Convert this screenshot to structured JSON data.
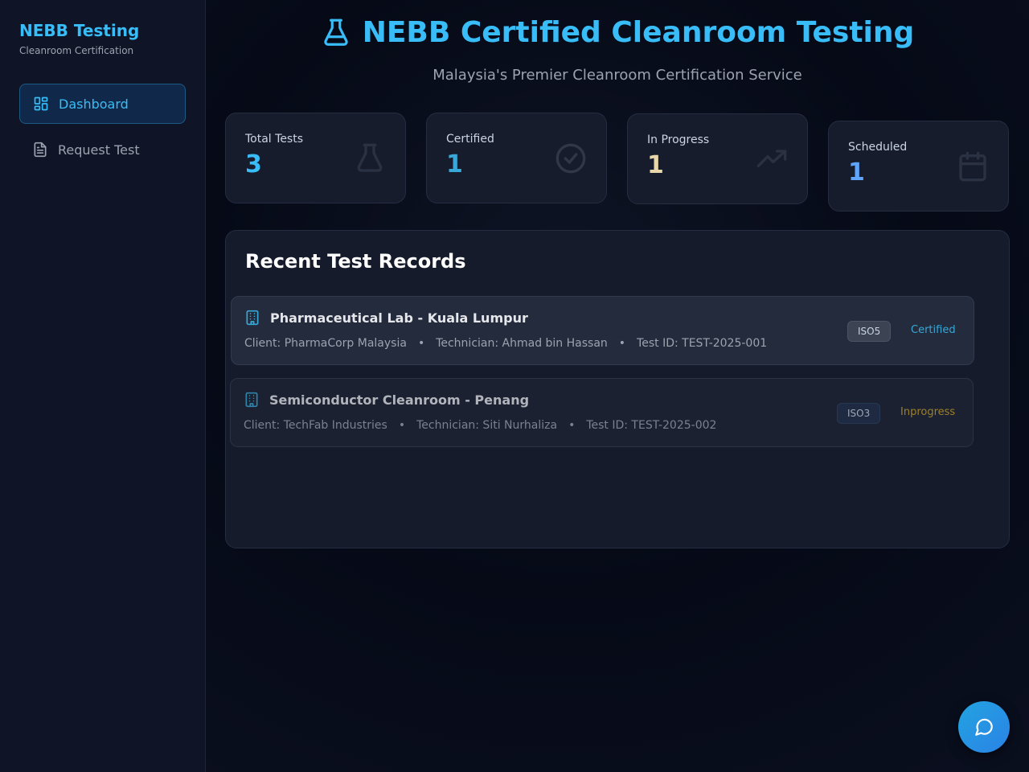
{
  "sidebar": {
    "title": "NEBB Testing",
    "subtitle": "Cleanroom Certification",
    "items": [
      {
        "label": "Dashboard",
        "icon": "dashboard-icon",
        "active": true
      },
      {
        "label": "Request Test",
        "icon": "document-icon",
        "active": false
      }
    ]
  },
  "header": {
    "title": "NEBB Certified Cleanroom Testing",
    "subtitle": "Malaysia's Premier Cleanroom Certification Service",
    "icon": "flask-icon"
  },
  "stats": [
    {
      "label": "Total Tests",
      "value": "3",
      "icon": "flask-icon"
    },
    {
      "label": "Certified",
      "value": "1",
      "icon": "check-circle-icon"
    },
    {
      "label": "In Progress",
      "value": "1",
      "icon": "trending-up-icon"
    },
    {
      "label": "Scheduled",
      "value": "1",
      "icon": "calendar-icon"
    }
  ],
  "records": {
    "title": "Recent Test Records",
    "items": [
      {
        "name": "Pharmaceutical Lab - Kuala Lumpur",
        "client": "Client: PharmaCorp Malaysia",
        "technician": "Technician: Ahmad bin Hassan",
        "test_id": "Test ID: TEST-2025-001",
        "iso": "ISO5",
        "status": "Certified"
      },
      {
        "name": "Semiconductor Cleanroom - Penang",
        "client": "Client: TechFab Industries",
        "technician": "Technician: Siti Nurhaliza",
        "test_id": "Test ID: TEST-2025-002",
        "iso": "ISO3",
        "status": "Inprogress"
      }
    ]
  },
  "colors": {
    "accent": "#38bdf8",
    "certified": "#38a8d8",
    "inprogress": "#c9a227",
    "scheduled": "#60a5fa"
  }
}
